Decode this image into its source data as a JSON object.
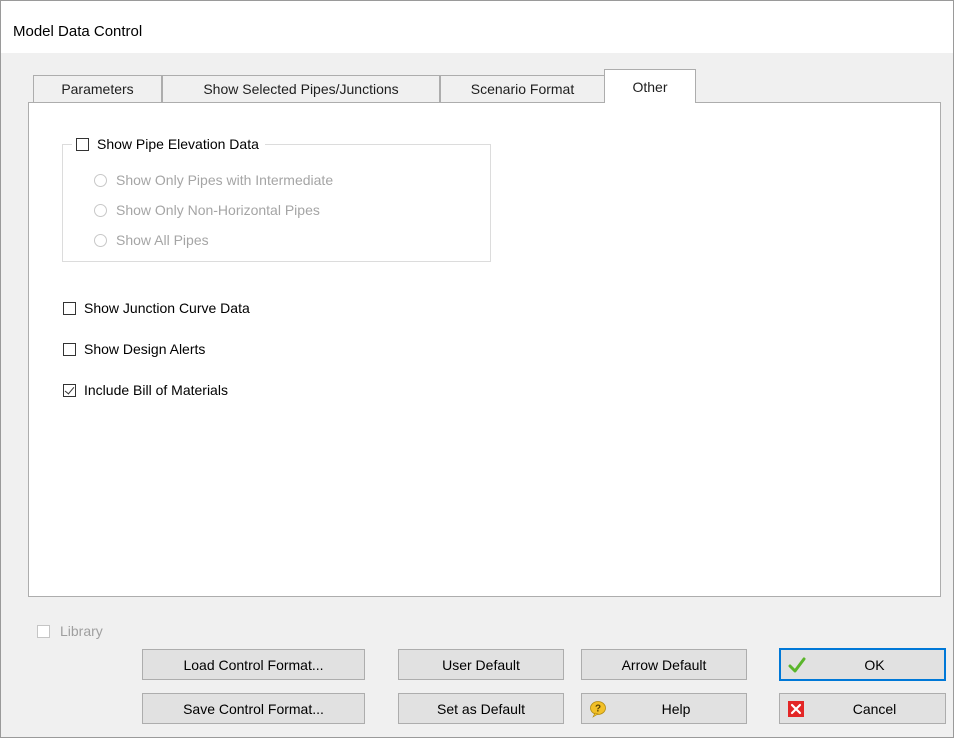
{
  "window": {
    "title": "Model Data Control"
  },
  "tabs": [
    {
      "label": "Parameters",
      "active": false
    },
    {
      "label": "Show Selected Pipes/Junctions",
      "active": false
    },
    {
      "label": "Scenario Format",
      "active": false
    },
    {
      "label": "Other",
      "active": true
    }
  ],
  "group": {
    "label": "Show Pipe Elevation Data",
    "checked": false,
    "options": [
      "Show Only Pipes with Intermediate",
      "Show Only Non-Horizontal Pipes",
      "Show All Pipes"
    ]
  },
  "checkboxes": {
    "junction_curve": {
      "label": "Show Junction Curve Data",
      "checked": false
    },
    "design_alerts": {
      "label": "Show Design Alerts",
      "checked": false
    },
    "bill_of_materials": {
      "label": "Include Bill of Materials",
      "checked": true
    }
  },
  "library": {
    "label": "Library",
    "checked": false,
    "enabled": false
  },
  "buttons": {
    "load_control_format": "Load Control Format...",
    "save_control_format": "Save Control Format...",
    "user_default": "User Default",
    "set_as_default": "Set as Default",
    "arrow_default": "Arrow Default",
    "help": "Help",
    "ok": "OK",
    "cancel": "Cancel"
  },
  "icons": {
    "ok": "checkmark-icon",
    "cancel": "red-x-icon",
    "help": "question-bubble-icon"
  },
  "colors": {
    "accent": "#0078d7",
    "ok_check": "#5ab52b",
    "cancel_red": "#e32626",
    "help_yellow": "#f2c028"
  }
}
